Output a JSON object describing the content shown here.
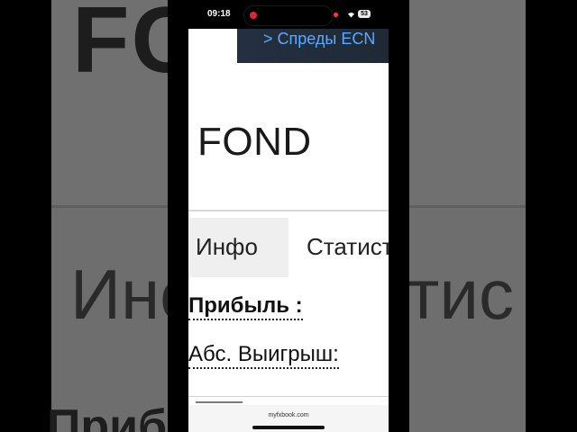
{
  "background": {
    "fond_text": "FC",
    "info_text": "Инс",
    "stat_text": "атис",
    "profit_text": "Приб"
  },
  "status_bar": {
    "time": "09:18",
    "battery": "53",
    "icons": [
      "recording-icon",
      "wifi-icon",
      "battery-icon"
    ]
  },
  "banner": {
    "text": "> Спреды ECN"
  },
  "header": {
    "title": "FOND"
  },
  "tabs": [
    {
      "label": "Инфо",
      "selected": false
    },
    {
      "label": "Статистика",
      "selected": true
    }
  ],
  "stats": {
    "profit_label": "Прибыль :",
    "abs_gain_label": "Абс. Выигрыш:"
  },
  "browser": {
    "url": "myfxbook.com"
  },
  "colors": {
    "banner_text": "#5ea8ff",
    "banner_bg": "#243040",
    "recording": "#e0243a"
  }
}
